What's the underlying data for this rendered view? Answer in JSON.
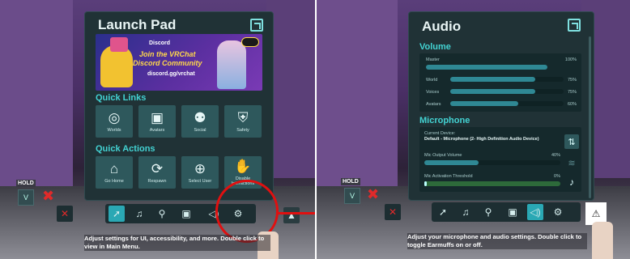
{
  "left_panel": {
    "title": "Launch Pad",
    "banner": {
      "brand": "Discord",
      "line1": "Join the VRChat",
      "line2": "Discord Community",
      "url": "discord.gg/vrchat"
    },
    "quick_links_title": "Quick Links",
    "quick_links": [
      {
        "label": "Worlds",
        "icon": "globe-icon",
        "glyph": "◎"
      },
      {
        "label": "Avatars",
        "icon": "avatar-book-icon",
        "glyph": "▣"
      },
      {
        "label": "Social",
        "icon": "people-icon",
        "glyph": "⚉"
      },
      {
        "label": "Safety",
        "icon": "shield-icon",
        "glyph": "⛨"
      }
    ],
    "quick_actions_title": "Quick Actions",
    "quick_actions": [
      {
        "label": "Go Home",
        "icon": "home-icon",
        "glyph": "⌂"
      },
      {
        "label": "Respawn",
        "icon": "respawn-icon",
        "glyph": "⟳"
      },
      {
        "label": "Select User",
        "icon": "crosshair-icon",
        "glyph": "⊕"
      },
      {
        "label": "Disable Interactions",
        "icon": "hand-icon",
        "glyph": "✋"
      }
    ],
    "hold_label": "HOLD",
    "hold_key": "V",
    "caption": "Adjust settings for UI, accessibility, and more. Double click to view in Main Menu."
  },
  "right_panel": {
    "title": "Audio",
    "volume_title": "Volume",
    "volume": [
      {
        "label": "Master",
        "value": "100%",
        "level": 1.0
      },
      {
        "label": "World",
        "value": "75%",
        "level": 0.75
      },
      {
        "label": "Voices",
        "value": "75%",
        "level": 0.75
      },
      {
        "label": "Avatars",
        "value": "60%",
        "level": 0.6
      }
    ],
    "microphone_title": "Microphone",
    "current_device_label": "Current Device:",
    "current_device": "Default - Microphone (2- High Definition Audio Device)",
    "mic_output_label": "Mic Output Volume",
    "mic_output_value": "40%",
    "mic_output_level": 0.4,
    "activation_label": "Mic Activation Threshold",
    "activation_value": "0%",
    "activation_level": 0.02,
    "hold_label": "HOLD",
    "hold_key": "V",
    "caption": "Adjust your microphone and audio settings. Double click to toggle Earmuffs on or off."
  },
  "colors": {
    "accent": "#43d3d3",
    "menu_bg": "#203236",
    "active_tab": "#2aa8b4",
    "highlight_circle": "#e01010",
    "mute_icon": "#e02a2a"
  }
}
